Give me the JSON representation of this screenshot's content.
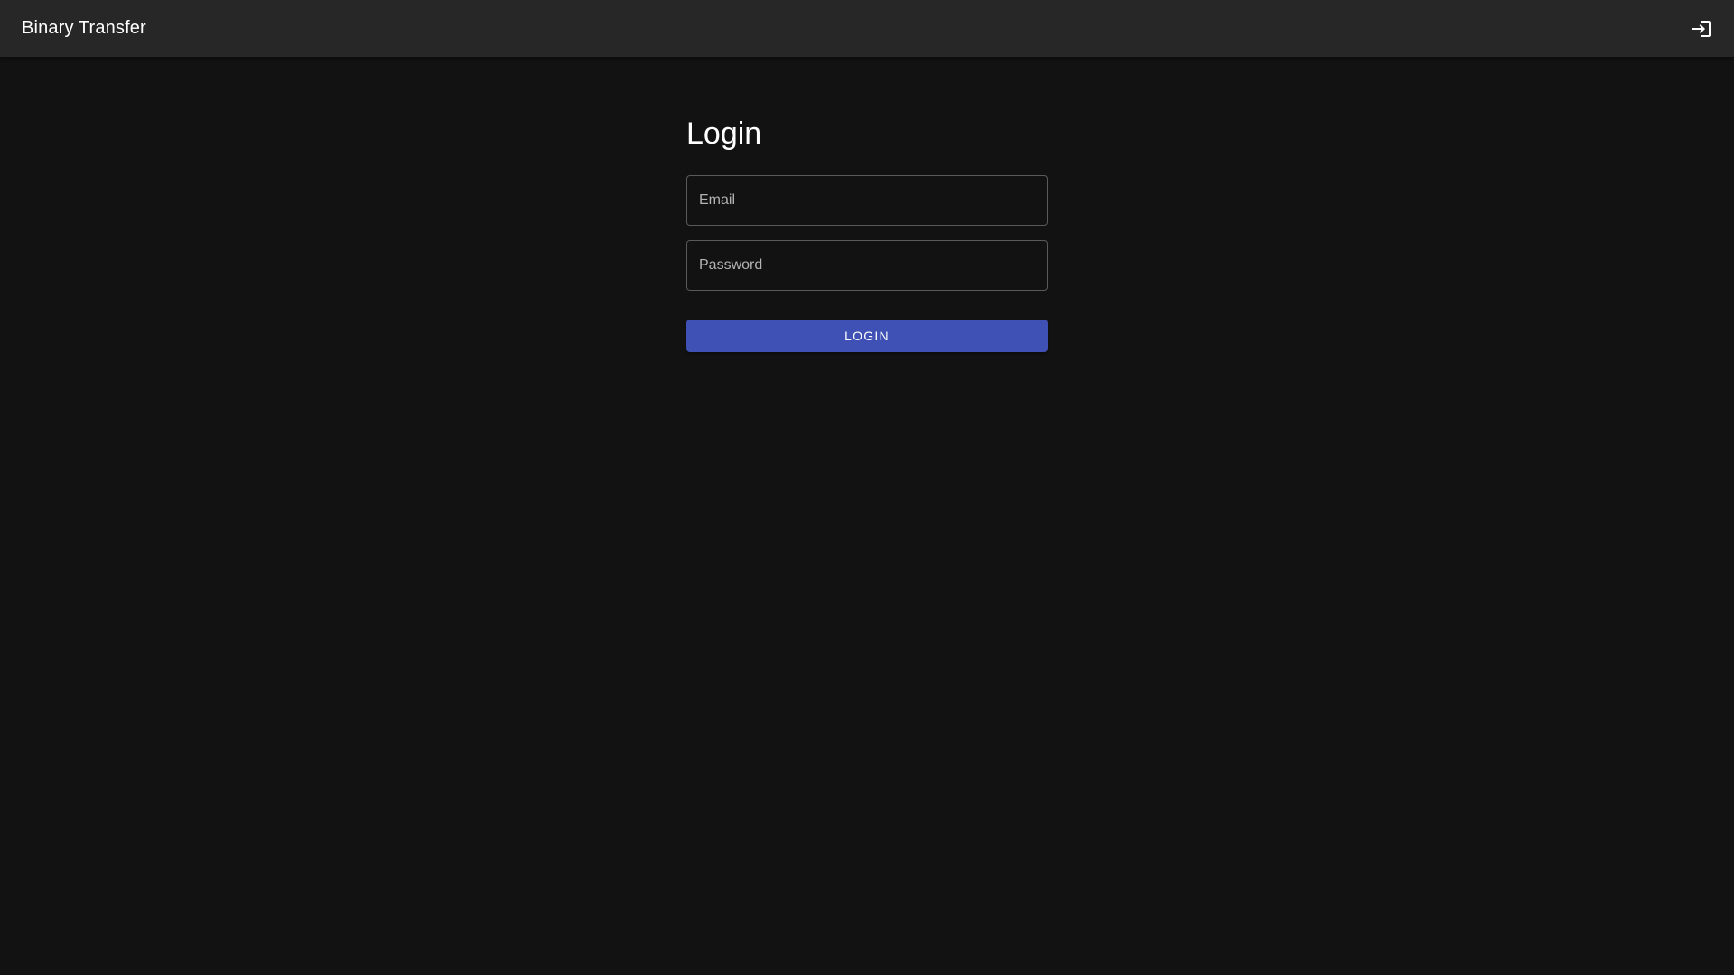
{
  "app_bar": {
    "title": "Binary Transfer",
    "action_icon": "login-icon"
  },
  "main": {
    "title": "Login",
    "email_field": {
      "placeholder": "Email",
      "value": ""
    },
    "password_field": {
      "placeholder": "Password",
      "value": ""
    },
    "login_button_label": "LOGIN"
  },
  "colors": {
    "background": "#121212",
    "app_bar": "#272727",
    "primary": "#3f51b5",
    "text": "#ffffff"
  }
}
